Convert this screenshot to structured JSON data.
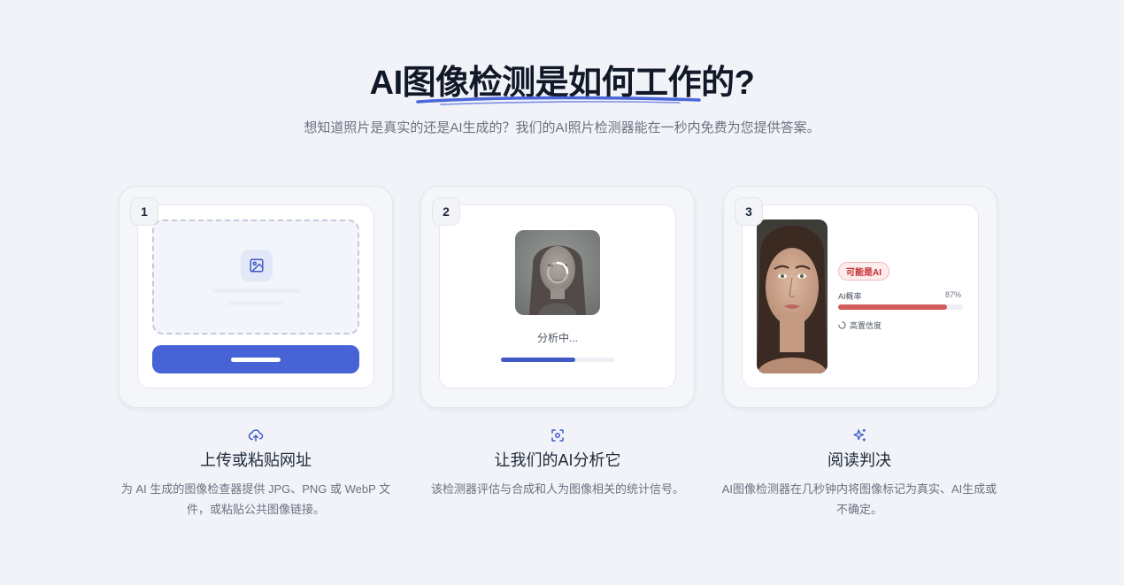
{
  "header": {
    "title": "AI图像检测是如何工作的?",
    "subtitle": "想知道照片是真实的还是AI生成的？我们的AI照片检测器能在一秒内免费为您提供答案。"
  },
  "steps": [
    {
      "number": "1",
      "icon": "cloud-upload-icon",
      "title": "上传或粘贴网址",
      "description": "为 AI 生成的图像检查器提供 JPG、PNG 或 WebP 文件，或粘贴公共图像链接。"
    },
    {
      "number": "2",
      "icon": "scan-icon",
      "title": "让我们的AI分析它",
      "description": "该检测器评估与合成和人为图像相关的统计信号。",
      "status_text": "分析中...",
      "progress": 0.66
    },
    {
      "number": "3",
      "icon": "sparkles-icon",
      "title": "阅读判决",
      "description": "AI图像检测器在几秒钟内将图像标记为真实、AI生成或不确定。",
      "verdict_badge": "可能是AI",
      "probability_label": "AI概率",
      "probability_value": "87%",
      "probability": 0.87,
      "confidence": "高置信度"
    }
  ],
  "colors": {
    "accent": "#4763d6",
    "danger": "#d35c5c",
    "background": "#f1f3f9"
  }
}
